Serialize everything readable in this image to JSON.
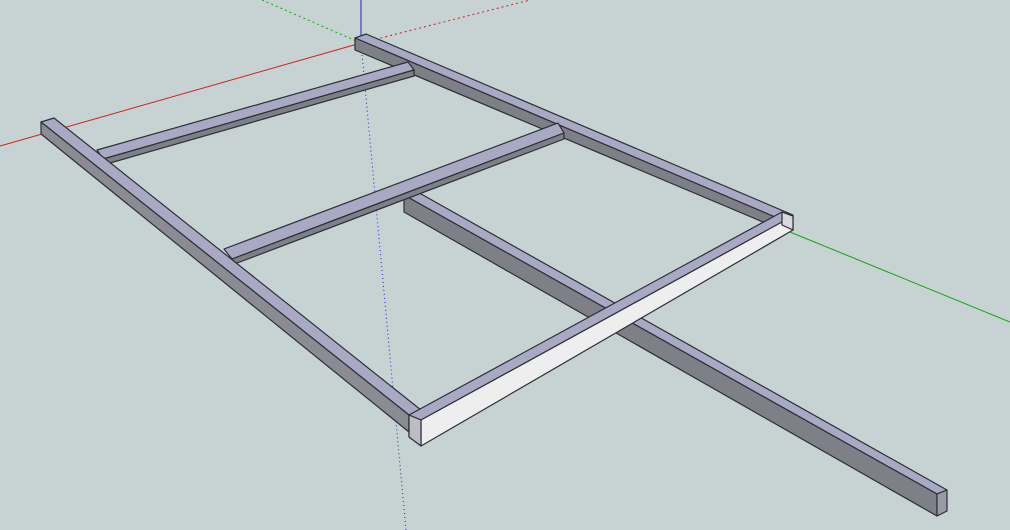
{
  "viewport": {
    "background": "#c7d2d3"
  },
  "axes": {
    "red": "#d21f1f",
    "green": "#15a315",
    "blue": "#2424c8"
  },
  "model": {
    "face_colors": {
      "top": "#a9a9c3",
      "side_light": "#b6b6bd",
      "side_dark": "#7f7f88",
      "front_white": "#eeeeee"
    },
    "parts": [
      "left-rail",
      "back-rail",
      "front-rail",
      "right-end",
      "crossbar-1",
      "crossbar-2",
      "long-beam"
    ]
  }
}
